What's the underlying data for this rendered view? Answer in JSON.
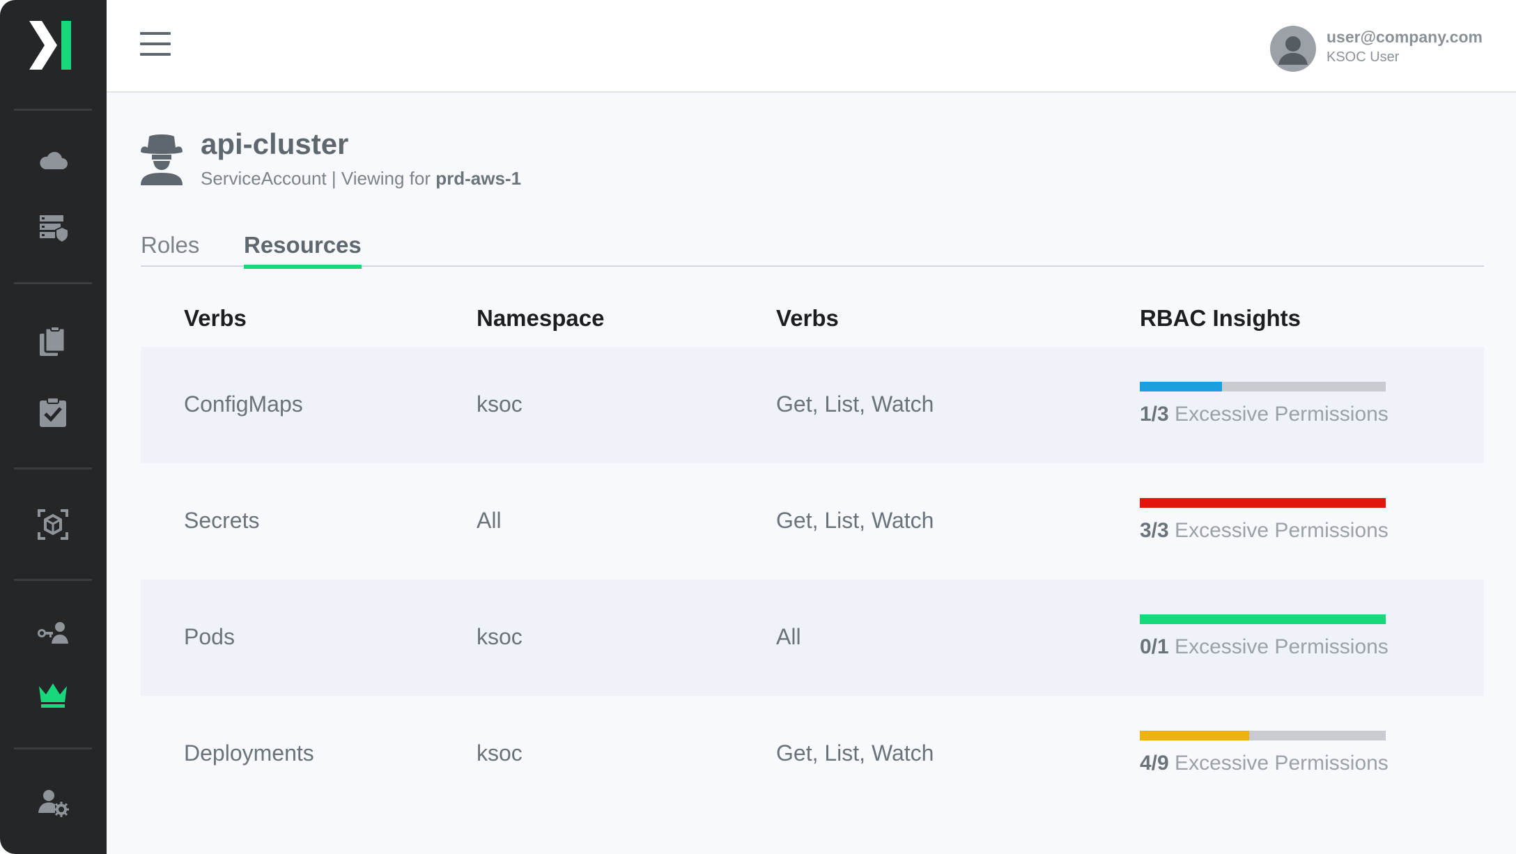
{
  "header": {
    "user_email": "user@company.com",
    "user_role": "KSOC User"
  },
  "entity": {
    "name": "api-cluster",
    "kind": "ServiceAccount",
    "viewing_prefix": " | Viewing for ",
    "cluster": "prd-aws-1"
  },
  "tabs": [
    {
      "label": "Roles",
      "active": false
    },
    {
      "label": "Resources",
      "active": true
    }
  ],
  "table": {
    "headers": [
      "Verbs",
      "Namespace",
      "Verbs",
      "RBAC Insights"
    ],
    "rows": [
      {
        "resource": "ConfigMaps",
        "namespace": "ksoc",
        "verbs": "Get, List, Watch",
        "ratio": "1/3",
        "excessive": 1,
        "total": 3,
        "color": "#1a9fdf"
      },
      {
        "resource": "Secrets",
        "namespace": "All",
        "verbs": "Get, List, Watch",
        "ratio": "3/3",
        "excessive": 3,
        "total": 3,
        "color": "#e0160c"
      },
      {
        "resource": "Pods",
        "namespace": "ksoc",
        "verbs": "All",
        "ratio": "0/1",
        "excessive": 0,
        "total": 1,
        "color": "#17d97c"
      },
      {
        "resource": "Deployments",
        "namespace": "ksoc",
        "verbs": "Get, List, Watch",
        "ratio": "4/9",
        "excessive": 4,
        "total": 9,
        "color": "#ecb30e"
      }
    ],
    "insight_suffix": " Excessive Permissions"
  },
  "sidebar": {
    "items": [
      {
        "icon": "cloud-icon"
      },
      {
        "icon": "server-shield-icon"
      },
      {
        "icon": "documents-icon"
      },
      {
        "icon": "clipboard-check-icon"
      },
      {
        "icon": "cube-scan-icon"
      },
      {
        "icon": "user-key-icon"
      },
      {
        "icon": "crown-icon",
        "active": true
      },
      {
        "icon": "user-gear-icon"
      }
    ]
  },
  "colors": {
    "brand_green": "#17d97c",
    "sidebar_bg": "#242627",
    "icon_gray": "#8e9499"
  }
}
